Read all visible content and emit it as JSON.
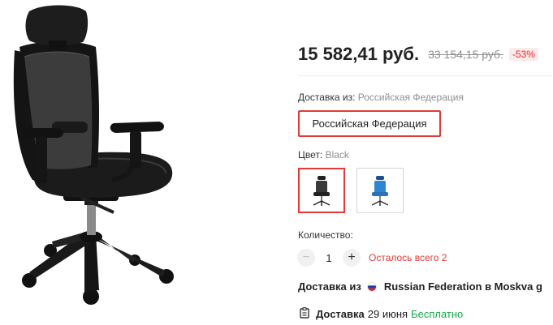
{
  "product": {
    "image_icon": "office-chair-image",
    "price": "15 582,41 руб.",
    "old_price": "33 154,15 руб.",
    "discount": "-53%"
  },
  "shipping_from": {
    "label": "Доставка из:",
    "value": "Российская Федерация",
    "option": "Российская Федерация"
  },
  "color": {
    "label": "Цвет:",
    "value": "Black",
    "options": [
      {
        "name": "Black",
        "icon": "black-chair-thumbnail",
        "selected": true
      },
      {
        "name": "Blue",
        "icon": "blue-chair-thumbnail",
        "selected": false
      }
    ]
  },
  "quantity": {
    "label": "Количество:",
    "minus": "−",
    "value": "1",
    "plus": "+",
    "stock_note": "Осталось всего 2"
  },
  "delivery_from": {
    "prefix": "Доставка из",
    "country": "Russian Federation",
    "suffix": "в Moskva g",
    "flag_icon": "russia-flag-icon"
  },
  "delivery": {
    "icon": "clipboard-icon",
    "label": "Доставка",
    "date": "29 июня",
    "cost": "Бесплатно"
  },
  "colors": {
    "accent": "#e53935",
    "free_shipping": "#17a84a",
    "muted": "#8f8f8f"
  }
}
